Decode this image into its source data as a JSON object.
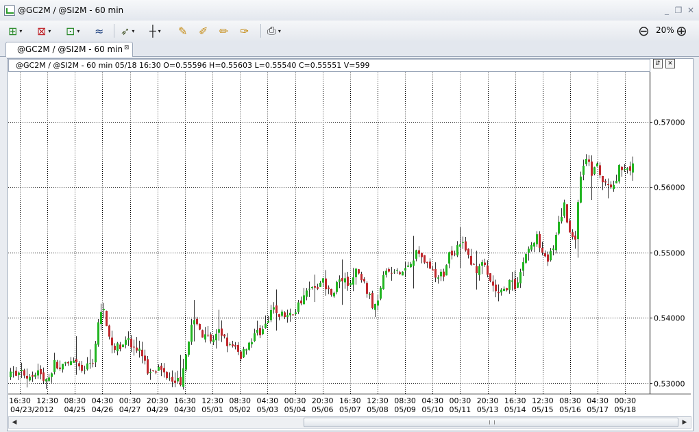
{
  "window": {
    "title": "@GC2M / @SI2M  - 60 min",
    "minimize": "_",
    "restore": "❐",
    "close": "✕"
  },
  "toolbar": {
    "zoom_out_glyph": "⊖",
    "zoom_in_glyph": "⊕",
    "zoom_level": "20%",
    "drop_glyph": "▾",
    "icons": {
      "insert_study": "⊞",
      "remove_study": "⊠",
      "edit_study": "⊡",
      "chart_style": "≈",
      "cursor": "➶",
      "crosshair": "┼",
      "draw_line": "✎",
      "draw_ray": "✐",
      "draw_channel": "✏",
      "draw_fib": "✑",
      "print": "⎙"
    }
  },
  "tab": {
    "label": "@GC2M / @SI2M  - 60 min",
    "close": "⊠"
  },
  "info": {
    "text": "@GC2M / @SI2M  - 60 min 05/18 16:30 O=0.55596 H=0.55603 L=0.55540 C=0.55551 V=599",
    "btn_a": "⇵",
    "btn_b": "✕"
  },
  "scroll": {
    "left": "◀",
    "right": "▶"
  },
  "colors": {
    "up": "#21b521",
    "down": "#c0282d",
    "wick": "#000000",
    "grid": "#000000"
  },
  "chart_data": {
    "type": "candlestick",
    "y_min": 0.5284,
    "y_max": 0.5778,
    "y_ticks": [
      0.53,
      0.54,
      0.55,
      0.56,
      0.57
    ],
    "y_tick_labels": [
      "0.53000",
      "0.54000",
      "0.55000",
      "0.56000",
      "0.57000"
    ],
    "x_labels": [
      [
        "16:30",
        "04/23/2012"
      ],
      [
        "12:30",
        ""
      ],
      [
        "08:30",
        "04/25"
      ],
      [
        "04:30",
        "04/26"
      ],
      [
        "00:30",
        "04/27"
      ],
      [
        "20:30",
        "04/29"
      ],
      [
        "16:30",
        "04/30"
      ],
      [
        "12:30",
        "05/01"
      ],
      [
        "08:30",
        "05/02"
      ],
      [
        "04:30",
        "05/03"
      ],
      [
        "00:30",
        "05/04"
      ],
      [
        "20:30",
        "05/06"
      ],
      [
        "16:30",
        "05/07"
      ],
      [
        "12:30",
        "05/08"
      ],
      [
        "08:30",
        "05/09"
      ],
      [
        "04:30",
        "05/10"
      ],
      [
        "00:30",
        "05/11"
      ],
      [
        "20:30",
        "05/13"
      ],
      [
        "16:30",
        "05/14"
      ],
      [
        "12:30",
        "05/15"
      ],
      [
        "08:30",
        "05/16"
      ],
      [
        "04:30",
        "05/17"
      ],
      [
        "00:30",
        "05/18"
      ]
    ],
    "close_path": [
      [
        0,
        0.5312
      ],
      [
        2,
        0.5315
      ],
      [
        4,
        0.5318
      ],
      [
        6,
        0.531
      ],
      [
        8,
        0.5316
      ],
      [
        10,
        0.5319
      ],
      [
        12,
        0.5305
      ],
      [
        14,
        0.531
      ],
      [
        16,
        0.533
      ],
      [
        18,
        0.5322
      ],
      [
        20,
        0.5326
      ],
      [
        22,
        0.533
      ],
      [
        24,
        0.5327
      ],
      [
        26,
        0.5318
      ],
      [
        28,
        0.5325
      ],
      [
        30,
        0.5335
      ],
      [
        32,
        0.539
      ],
      [
        34,
        0.542
      ],
      [
        36,
        0.5365
      ],
      [
        38,
        0.5352
      ],
      [
        40,
        0.5358
      ],
      [
        42,
        0.5372
      ],
      [
        44,
        0.5356
      ],
      [
        46,
        0.535
      ],
      [
        48,
        0.5345
      ],
      [
        50,
        0.5318
      ],
      [
        52,
        0.5324
      ],
      [
        54,
        0.5322
      ],
      [
        56,
        0.5316
      ],
      [
        58,
        0.5311
      ],
      [
        60,
        0.5306
      ],
      [
        62,
        0.5302
      ],
      [
        64,
        0.535
      ],
      [
        66,
        0.5385
      ],
      [
        68,
        0.5395
      ],
      [
        70,
        0.5372
      ],
      [
        72,
        0.5368
      ],
      [
        74,
        0.5362
      ],
      [
        76,
        0.5378
      ],
      [
        78,
        0.5372
      ],
      [
        80,
        0.5355
      ],
      [
        82,
        0.5352
      ],
      [
        84,
        0.5342
      ],
      [
        86,
        0.5358
      ],
      [
        88,
        0.5367
      ],
      [
        90,
        0.5378
      ],
      [
        92,
        0.5382
      ],
      [
        94,
        0.5395
      ],
      [
        96,
        0.5415
      ],
      [
        98,
        0.5405
      ],
      [
        100,
        0.5404
      ],
      [
        102,
        0.5403
      ],
      [
        104,
        0.5412
      ],
      [
        106,
        0.5428
      ],
      [
        108,
        0.544
      ],
      [
        110,
        0.5444
      ],
      [
        112,
        0.545
      ],
      [
        114,
        0.5456
      ],
      [
        116,
        0.5442
      ],
      [
        118,
        0.5442
      ],
      [
        120,
        0.546
      ],
      [
        122,
        0.5454
      ],
      [
        124,
        0.5452
      ],
      [
        126,
        0.547
      ],
      [
        128,
        0.546
      ],
      [
        130,
        0.5442
      ],
      [
        132,
        0.5418
      ],
      [
        134,
        0.5432
      ],
      [
        136,
        0.5472
      ],
      [
        138,
        0.5468
      ],
      [
        140,
        0.547
      ],
      [
        142,
        0.5466
      ],
      [
        144,
        0.5475
      ],
      [
        146,
        0.5488
      ],
      [
        148,
        0.55
      ],
      [
        150,
        0.5495
      ],
      [
        152,
        0.5482
      ],
      [
        154,
        0.547
      ],
      [
        156,
        0.546
      ],
      [
        158,
        0.5468
      ],
      [
        160,
        0.5497
      ],
      [
        162,
        0.5504
      ],
      [
        164,
        0.5518
      ],
      [
        166,
        0.5503
      ],
      [
        168,
        0.5483
      ],
      [
        170,
        0.5472
      ],
      [
        172,
        0.5488
      ],
      [
        174,
        0.546
      ],
      [
        176,
        0.5446
      ],
      [
        178,
        0.5435
      ],
      [
        180,
        0.5441
      ],
      [
        182,
        0.5455
      ],
      [
        184,
        0.5448
      ],
      [
        186,
        0.547
      ],
      [
        188,
        0.55
      ],
      [
        190,
        0.551
      ],
      [
        192,
        0.5522
      ],
      [
        194,
        0.5506
      ],
      [
        196,
        0.549
      ],
      [
        198,
        0.5504
      ],
      [
        200,
        0.554
      ],
      [
        202,
        0.5572
      ],
      [
        204,
        0.553
      ],
      [
        206,
        0.5524
      ],
      [
        208,
        0.562
      ],
      [
        210,
        0.5648
      ],
      [
        212,
        0.562
      ],
      [
        214,
        0.563
      ],
      [
        216,
        0.5608
      ],
      [
        218,
        0.56
      ],
      [
        220,
        0.5602
      ],
      [
        222,
        0.563
      ]
    ]
  }
}
